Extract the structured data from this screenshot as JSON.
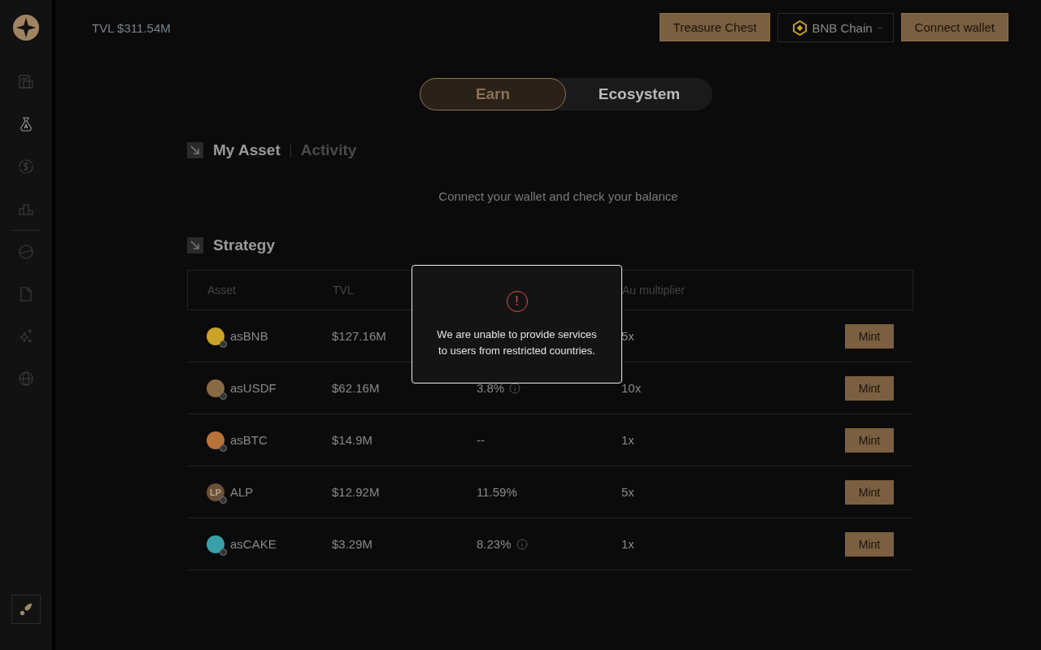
{
  "sidebar": {
    "items": [
      {
        "kind": "chart",
        "selected": false
      },
      {
        "kind": "bag",
        "selected": true
      },
      {
        "kind": "dollar",
        "selected": false
      },
      {
        "kind": "podium",
        "selected": false
      }
    ],
    "secondary": [
      {
        "kind": "planet",
        "selected": false
      },
      {
        "kind": "document",
        "selected": false
      },
      {
        "kind": "sparkle",
        "selected": false
      },
      {
        "kind": "globe",
        "selected": false
      }
    ]
  },
  "header": {
    "tvl": "TVL $311.54M",
    "buttons": [
      {
        "kind": "gold",
        "label": "Treasure Chest"
      },
      {
        "kind": "chain",
        "label": "BNB Chain"
      },
      {
        "kind": "gold",
        "label": "Connect wallet"
      }
    ]
  },
  "toggle": [
    {
      "label": "Earn",
      "selected": true
    },
    {
      "label": "Ecosystem",
      "selected": false
    }
  ],
  "asset_tabs": [
    {
      "label": "My Asset",
      "selected": true
    },
    {
      "label": "Activity",
      "selected": false
    }
  ],
  "asset_message": "Connect your wallet and check your balance",
  "strategy": {
    "title": "Strategy",
    "columns": [
      "Asset",
      "TVL",
      "Au multiplier"
    ],
    "rows": [
      {
        "asset": "asBNB",
        "color": "#c9a227",
        "tvl": "$127.16M",
        "multiplier": "5x",
        "action": "Mint"
      },
      {
        "asset": "asUSDF",
        "color": "#8a6a45",
        "tvl": "$62.16M",
        "apr": "3.8%",
        "info": true,
        "multiplier": "10x",
        "action": "Mint"
      },
      {
        "asset": "asBTC",
        "color": "#b8733a",
        "tvl": "$14.9M",
        "apr": "--",
        "info": false,
        "multiplier": "1x",
        "action": "Mint"
      },
      {
        "asset": "ALP",
        "color": "#6b5038",
        "icon_label": "LP",
        "tvl": "$12.92M",
        "apr": "11.59%",
        "info": false,
        "multiplier": "5x",
        "action": "Mint"
      },
      {
        "asset": "asCAKE",
        "color": "#3aa0a8",
        "tvl": "$3.29M",
        "apr": "8.23%",
        "info": true,
        "multiplier": "1x",
        "action": "Mint"
      }
    ]
  },
  "modal": {
    "icon": "!",
    "message": "We are unable to provide services to users from restricted countries."
  }
}
